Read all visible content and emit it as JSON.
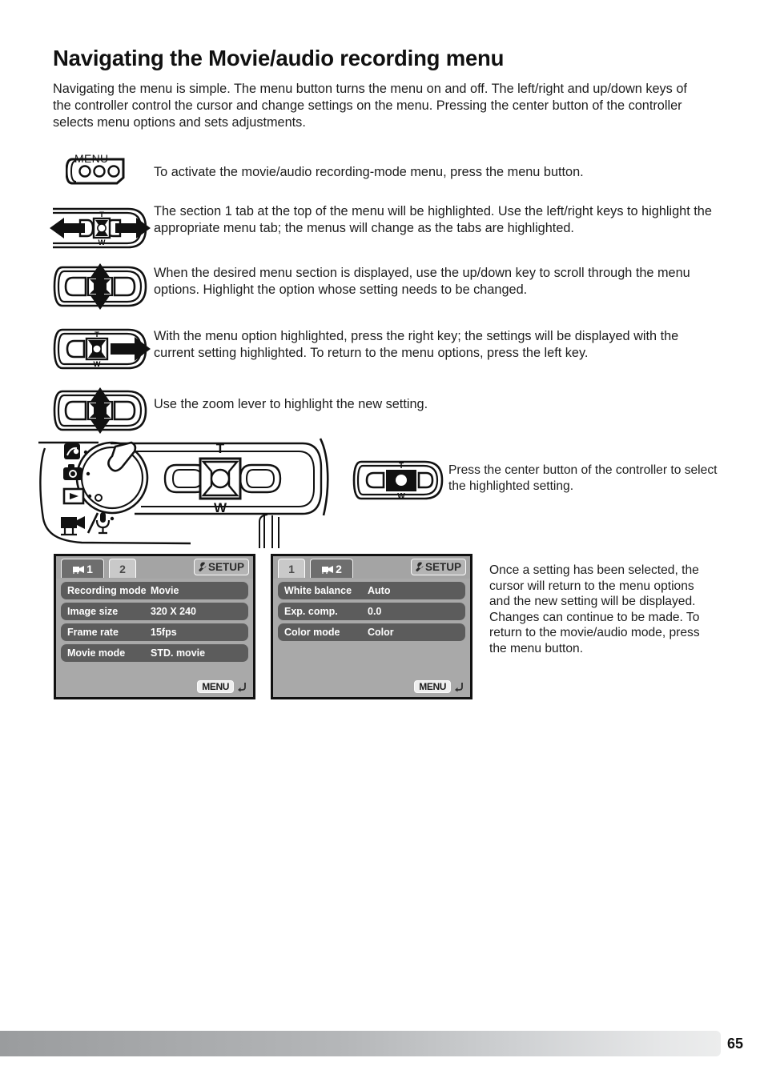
{
  "page": {
    "title": "Navigating the Movie/audio recording menu",
    "intro": "Navigating the menu is simple. The menu button turns the menu on and off. The left/right and up/down keys of the controller control the cursor and change settings on the menu. Pressing the center button of the controller selects menu options and sets adjustments.",
    "number": "65"
  },
  "steps": [
    {
      "icon": "menu-button",
      "icon_label": "MENU",
      "text": "To activate the movie/audio recording-mode menu, press the menu button."
    },
    {
      "icon": "controller-left-right",
      "text": "The section 1 tab at the top of the menu will be highlighted. Use the left/right keys to highlight the appropriate menu tab; the menus will change as the tabs are highlighted."
    },
    {
      "icon": "controller-up-down",
      "text": "When the desired menu section is displayed, use the up/down key to scroll through the menu options. Highlight the option whose setting needs to be changed."
    },
    {
      "icon": "controller-right",
      "text": "With the menu option highlighted, press the right key; the settings will be displayed with the current setting highlighted. To return to the menu options, press the left key."
    },
    {
      "icon": "zoom-lever-up-down",
      "text": "Use the zoom lever to highlight the new setting."
    }
  ],
  "camera": {
    "zoom_tele_label": "T",
    "zoom_wide_label": "W",
    "dial_modes": [
      "scene-icon",
      "camera-icon",
      "playback-icon",
      "movie-audio-icon"
    ]
  },
  "center_press": {
    "icon": "controller-center-button",
    "tele_label": "T",
    "wide_label": "W",
    "text": "Press the center button of the controller to select the highlighted setting."
  },
  "lcd_left": {
    "tabs": [
      {
        "label": "1",
        "icon": "movie-camera-icon",
        "active": true
      },
      {
        "label": "2",
        "icon": "",
        "active": false
      }
    ],
    "setup_label": "SETUP",
    "setup_icon": "wrench-icon",
    "rows": [
      {
        "label": "Recording mode",
        "value": "Movie"
      },
      {
        "label": "Image size",
        "value": "320 X 240"
      },
      {
        "label": "Frame rate",
        "value": "15fps"
      },
      {
        "label": "Movie mode",
        "value": "STD. movie"
      }
    ],
    "footer_label": "MENU",
    "footer_icon": "return-arrow-icon"
  },
  "lcd_right": {
    "tabs": [
      {
        "label": "1",
        "icon": "",
        "active": false
      },
      {
        "label": "2",
        "icon": "movie-camera-icon",
        "active": true
      }
    ],
    "setup_label": "SETUP",
    "setup_icon": "wrench-icon",
    "rows": [
      {
        "label": "White balance",
        "value": "Auto"
      },
      {
        "label": "Exp. comp.",
        "value": "0.0"
      },
      {
        "label": "Color mode",
        "value": "Color"
      }
    ],
    "footer_label": "MENU",
    "footer_icon": "return-arrow-icon"
  },
  "final_note": "Once a setting has been selected, the cursor will return to the menu options and the new setting will be displayed. Changes can continue to be made. To return to the movie/audio mode, press the menu button."
}
